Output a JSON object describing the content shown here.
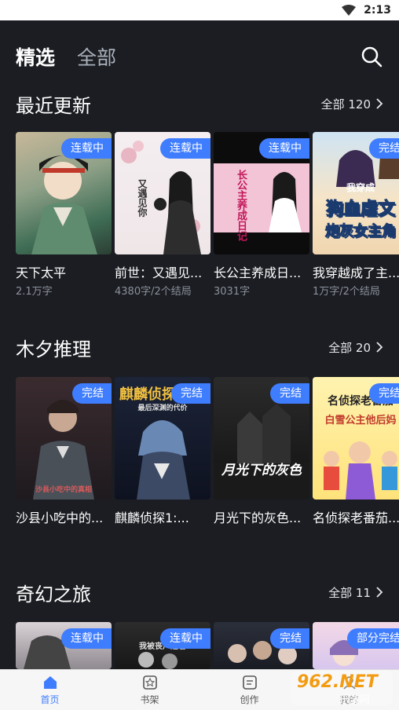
{
  "status": {
    "time": "2:13"
  },
  "tabs": [
    {
      "label": "精选"
    },
    {
      "label": "全部"
    }
  ],
  "sections": [
    {
      "title": "最近更新",
      "more": "全部 120",
      "books": [
        {
          "title": "天下太平",
          "meta": "2.1万字",
          "badge": "连载中"
        },
        {
          "title": "前世：又遇见...",
          "meta": "4380字/2个结局",
          "badge": "连载中"
        },
        {
          "title": "长公主养成日...",
          "meta": "3031字",
          "badge": "连载中"
        },
        {
          "title": "我穿越成了主...",
          "meta": "1万字/2个结局",
          "badge": "完结"
        }
      ]
    },
    {
      "title": "木夕推理",
      "more": "全部 20",
      "books": [
        {
          "title": "沙县小吃中的...",
          "meta": "",
          "badge": "完结"
        },
        {
          "title": "麒麟侦探1:...",
          "meta": "",
          "badge": "完结"
        },
        {
          "title": "月光下的灰色...",
          "meta": "",
          "badge": "完结"
        },
        {
          "title": "名侦探老番茄...",
          "meta": "",
          "badge": "完结"
        }
      ]
    },
    {
      "title": "奇幻之旅",
      "more": "全部 11",
      "books": [
        {
          "badge": "连载中"
        },
        {
          "badge": "连载中"
        },
        {
          "badge": "完结"
        },
        {
          "badge": "部分完结"
        }
      ]
    }
  ],
  "cover_text": {
    "b2": "又遇见你",
    "b3": "长公主养成日记",
    "b4a": "我穿成",
    "b4b": "狗血虐文",
    "b4c": "炮灰女主角",
    "m1": "沙县小吃中的真相",
    "m2a": "麒麟侦探",
    "m2b": "最后深渊的代价",
    "m3": "月光下的灰色",
    "m4a": "名侦探老番茄",
    "m4b": "白雪公主他后妈",
    "f2": "我被丧尸追着"
  },
  "bottom_nav": [
    {
      "label": "首页",
      "icon": "home-icon"
    },
    {
      "label": "书架",
      "icon": "bookshelf-icon"
    },
    {
      "label": "创作",
      "icon": "create-icon"
    },
    {
      "label": "我的",
      "icon": "profile-icon"
    }
  ],
  "watermark": {
    "line1": "962.NET",
    "line2": "乐游网"
  },
  "colors": {
    "background": "#1b1d22",
    "badge": "#3f7dff",
    "active_nav": "#3f7dff"
  }
}
